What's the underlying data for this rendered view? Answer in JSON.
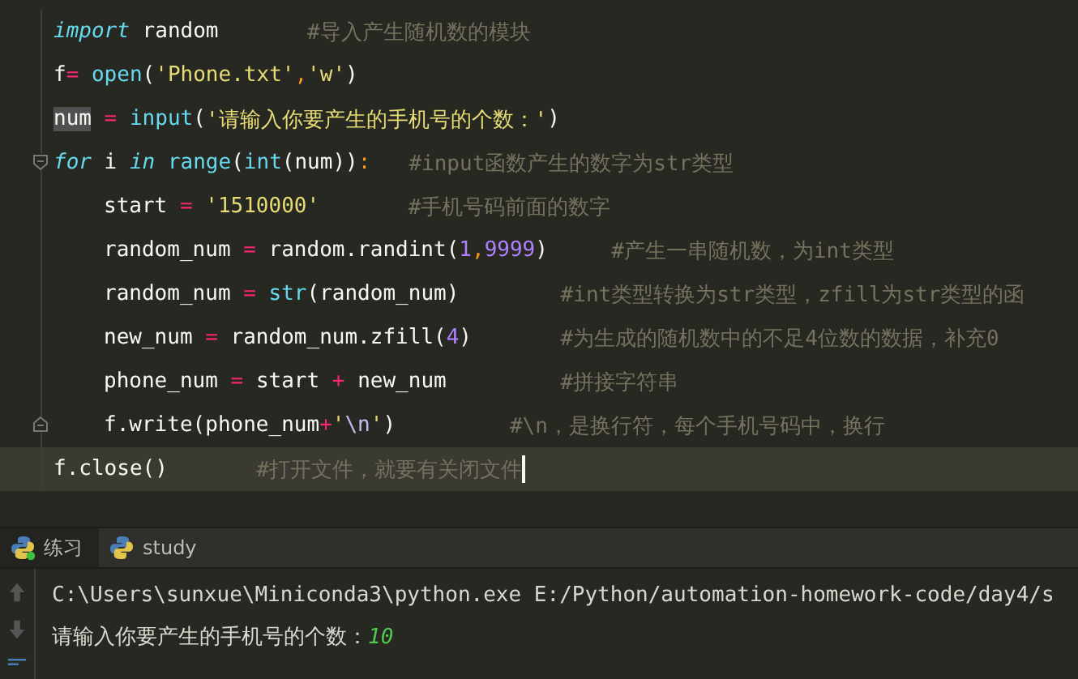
{
  "editor": {
    "lines": [
      {
        "current": false,
        "tokens": [
          {
            "t": "import ",
            "kind": "kw"
          },
          {
            "t": "random       ",
            "kind": "plain"
          },
          {
            "t": "#导入产生随机数的模块",
            "kind": "comment"
          }
        ]
      },
      {
        "current": false,
        "tokens": [
          {
            "t": "f",
            "kind": "plain"
          },
          {
            "t": "= ",
            "kind": "op"
          },
          {
            "t": "open",
            "kind": "builtin"
          },
          {
            "t": "(",
            "kind": "plain"
          },
          {
            "t": "'Phone.txt'",
            "kind": "str"
          },
          {
            "t": ",",
            "kind": "punct"
          },
          {
            "t": "'w'",
            "kind": "str"
          },
          {
            "t": ")",
            "kind": "plain"
          }
        ]
      },
      {
        "current": false,
        "tokens": [
          {
            "t": "num",
            "kind": "plain",
            "highlighted": true
          },
          {
            "t": " = ",
            "kind": "op"
          },
          {
            "t": "input",
            "kind": "builtin"
          },
          {
            "t": "(",
            "kind": "plain"
          },
          {
            "t": "'请输入你要产生的手机号的个数：'",
            "kind": "str"
          },
          {
            "t": ")",
            "kind": "plain"
          }
        ]
      },
      {
        "current": false,
        "expanded": true,
        "tokens": [
          {
            "t": "for",
            "kind": "kw"
          },
          {
            "t": " i ",
            "kind": "plain"
          },
          {
            "t": "in ",
            "kind": "kw"
          },
          {
            "t": "range",
            "kind": "builtin"
          },
          {
            "t": "(",
            "kind": "plain"
          },
          {
            "t": "int",
            "kind": "builtin"
          },
          {
            "t": "(num))",
            "kind": "plain"
          },
          {
            "t": ":   ",
            "kind": "punct"
          },
          {
            "t": "#input函数产生的数字为str类型",
            "kind": "comment"
          }
        ],
        "children": [
          {
            "current": false,
            "tokens": [
              {
                "t": "start",
                "kind": "plain"
              },
              {
                "t": " = ",
                "kind": "op"
              },
              {
                "t": "'1510000'       ",
                "kind": "str"
              },
              {
                "t": "#手机号码前面的数字",
                "kind": "comment"
              }
            ]
          },
          {
            "current": false,
            "tokens": [
              {
                "t": "random_num",
                "kind": "plain"
              },
              {
                "t": " = ",
                "kind": "op"
              },
              {
                "t": "random.randint(",
                "kind": "plain"
              },
              {
                "t": "1",
                "kind": "num"
              },
              {
                "t": ",",
                "kind": "punct"
              },
              {
                "t": "9999",
                "kind": "num"
              },
              {
                "t": ")     ",
                "kind": "plain"
              },
              {
                "t": "#产生一串随机数，为int类型",
                "kind": "comment"
              }
            ]
          },
          {
            "current": false,
            "tokens": [
              {
                "t": "random_num",
                "kind": "plain"
              },
              {
                "t": " = ",
                "kind": "op"
              },
              {
                "t": "str",
                "kind": "builtin"
              },
              {
                "t": "(random_num)        ",
                "kind": "plain"
              },
              {
                "t": "#int类型转换为str类型，zfill为str类型的函",
                "kind": "comment"
              }
            ]
          },
          {
            "current": false,
            "tokens": [
              {
                "t": "new_num",
                "kind": "plain"
              },
              {
                "t": " = ",
                "kind": "op"
              },
              {
                "t": "random_num.zfill(",
                "kind": "plain"
              },
              {
                "t": "4",
                "kind": "num"
              },
              {
                "t": ")       ",
                "kind": "plain"
              },
              {
                "t": "#为生成的随机数中的不足4位数的数据，补充0",
                "kind": "comment"
              }
            ]
          },
          {
            "current": false,
            "tokens": [
              {
                "t": "phone_num",
                "kind": "plain"
              },
              {
                "t": " = ",
                "kind": "op"
              },
              {
                "t": "start",
                "kind": "plain"
              },
              {
                "t": " + ",
                "kind": "op"
              },
              {
                "t": "new_num         ",
                "kind": "plain"
              },
              {
                "t": "#拼接字符串",
                "kind": "comment"
              }
            ]
          },
          {
            "current": false,
            "tokens": [
              {
                "t": "f.write(phone_num",
                "kind": "plain"
              },
              {
                "t": "+",
                "kind": "op"
              },
              {
                "t": "'",
                "kind": "str"
              },
              {
                "t": "\\n",
                "kind": "esc"
              },
              {
                "t": "'",
                "kind": "str"
              },
              {
                "t": ")         ",
                "kind": "plain"
              },
              {
                "t": "#\\n，是换行符，每个手机号码中，换行",
                "kind": "comment"
              }
            ]
          }
        ]
      },
      {
        "current": true,
        "tokens": [
          {
            "t": "f.close()       ",
            "kind": "plain"
          },
          {
            "t": "#打开文件，就要有关闭文件",
            "kind": "comment"
          }
        ]
      }
    ]
  },
  "run_tabs": [
    {
      "label": "练习",
      "selected": true,
      "running": true
    },
    {
      "label": "study",
      "selected": false,
      "running": false
    }
  ],
  "console": {
    "command": "C:\\Users\\sunxue\\Miniconda3\\python.exe E:/Python/automation-homework-code/day4/s",
    "prompt": "请输入你要产生的手机号的个数：",
    "input": "10"
  }
}
